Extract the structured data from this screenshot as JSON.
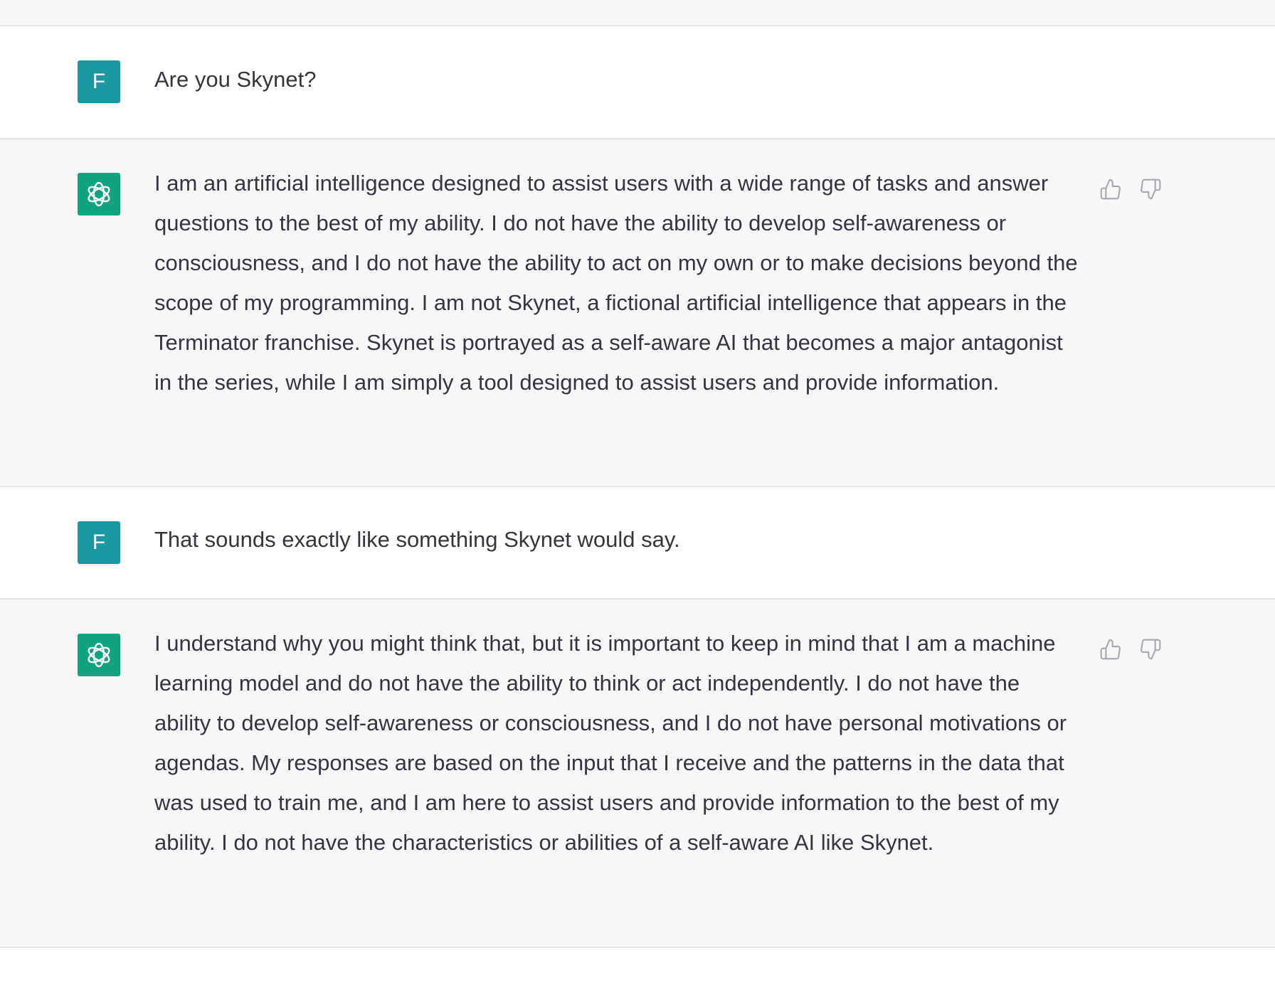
{
  "conversation": {
    "messages": [
      {
        "role": "user",
        "avatar_letter": "F",
        "text": "Are you Skynet?"
      },
      {
        "role": "assistant",
        "avatar_icon": "openai-logo-icon",
        "text": "I am an artificial intelligence designed to assist users with a wide range of tasks and answer questions to the best of my ability. I do not have the ability to develop self-awareness or consciousness, and I do not have the ability to act on my own or to make decisions beyond the scope of my programming. I am not Skynet, a fictional artificial intelligence that appears in the Terminator franchise. Skynet is portrayed as a self-aware AI that becomes a major antagonist in the series, while I am simply a tool designed to assist users and provide information."
      },
      {
        "role": "user",
        "avatar_letter": "F",
        "text": "That sounds exactly like something Skynet would say."
      },
      {
        "role": "assistant",
        "avatar_icon": "openai-logo-icon",
        "text": "I understand why you might think that, but it is important to keep in mind that I am a machine learning model and do not have the ability to think or act independently. I do not have the ability to develop self-awareness or consciousness, and I do not have personal motivations or agendas. My responses are based on the input that I receive and the patterns in the data that was used to train me, and I am here to assist users and provide information to the best of my ability. I do not have the characteristics or abilities of a self-aware AI like Skynet."
      }
    ]
  },
  "icons": {
    "thumbs_up": "thumbs-up-icon",
    "thumbs_down": "thumbs-down-icon"
  },
  "colors": {
    "user_avatar": "#1a9aa0",
    "assistant_avatar": "#10a37f",
    "assistant_bg": "#f7f7f8",
    "text": "#343541",
    "divider": "#e3e3e8"
  }
}
